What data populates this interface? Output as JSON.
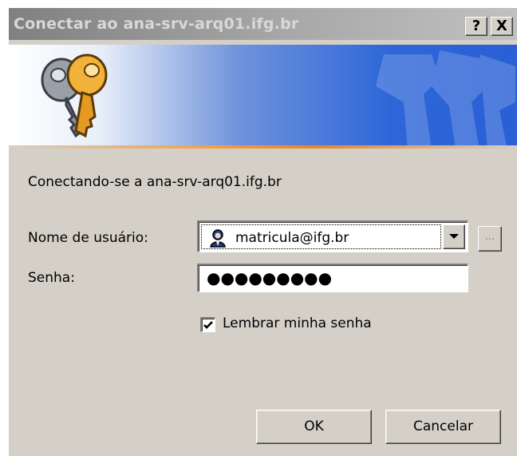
{
  "window": {
    "title": "Conectar ao ana-srv-arq01.ifg.br",
    "help_button": "?",
    "close_button": "X"
  },
  "dialog": {
    "connecting_text": "Conectando-se a ana-srv-arq01.ifg.br",
    "username_label": "Nome de usuário:",
    "username_value": "matricula@ifg.br",
    "browse_label": "...",
    "password_label": "Senha:",
    "password_mask": "●●●●●●●●●",
    "remember_label": "Lembrar minha senha",
    "remember_checked": true,
    "ok_label": "OK",
    "cancel_label": "Cancelar"
  },
  "colors": {
    "accent_blue": "#2e66d8",
    "banner_line": "#e98525",
    "dialog_bg": "#d4d0c8"
  },
  "icons": [
    "keys-icon",
    "user-icon",
    "dropdown-arrow-icon",
    "checkmark-icon"
  ]
}
